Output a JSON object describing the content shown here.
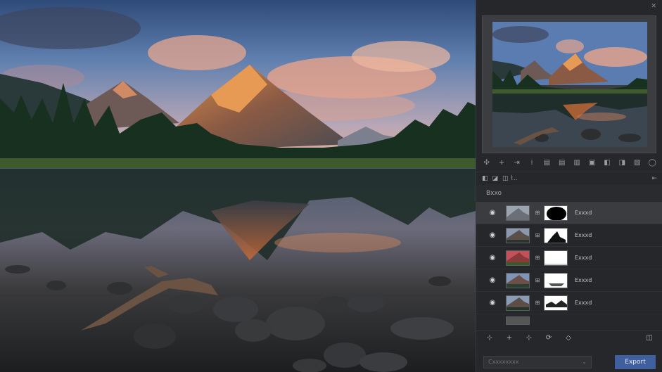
{
  "window": {
    "close_glyph": "✕"
  },
  "toolbar_icons": [
    "✣",
    "+",
    "⇥",
    "⁞",
    "▤",
    "▤",
    "▥",
    "▣",
    "◧",
    "◨",
    "▧",
    "◯"
  ],
  "layer_tabs": {
    "tab_a": "◧",
    "tab_b": "◪",
    "tab_c": "◫ ⌇..",
    "collapse_glyph": "⇤"
  },
  "layers_panel": {
    "header": "Bxxo"
  },
  "layers": [
    {
      "name": "Exxxd",
      "selected": true
    },
    {
      "name": "Exxxd",
      "selected": false
    },
    {
      "name": "Exxxd",
      "selected": false
    },
    {
      "name": "Exxxd",
      "selected": false
    },
    {
      "name": "Exxxd",
      "selected": false
    }
  ],
  "bottom_tools": [
    "⊹",
    "+",
    "⊹",
    "⟳",
    "◇",
    "◫"
  ],
  "footer": {
    "select_value": "Cxxxxxxxx",
    "export_label": "Export"
  },
  "colors": {
    "accent": "#3f5f9e",
    "panel_bg": "#26272a"
  }
}
